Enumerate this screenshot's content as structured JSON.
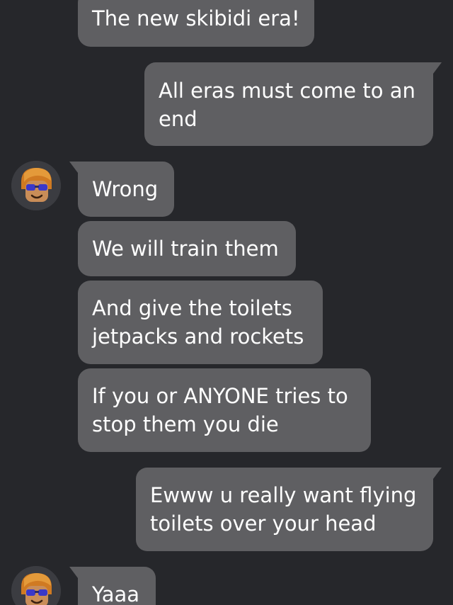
{
  "chat": {
    "messages": [
      {
        "sender": "other",
        "lines": [
          "The new skibidi era!"
        ]
      },
      {
        "sender": "me",
        "lines": [
          "All eras must come to an",
          "end"
        ]
      },
      {
        "sender": "other",
        "lines": [
          "Wrong"
        ]
      },
      {
        "sender": "other",
        "lines": [
          "We will train them"
        ]
      },
      {
        "sender": "other",
        "lines": [
          "And give the toilets",
          "jetpacks and rockets"
        ]
      },
      {
        "sender": "other",
        "lines": [
          "If you or ANYONE tries to",
          "stop them you die"
        ]
      },
      {
        "sender": "me",
        "lines": [
          "Ewww u really want flying",
          "toilets over your head"
        ]
      },
      {
        "sender": "other",
        "lines": [
          "Yaaa"
        ]
      }
    ]
  },
  "colors": {
    "background": "#26272b",
    "bubble": "#5f5f62",
    "text": "#ffffff"
  },
  "icons": {
    "avatar": "user-avatar-icon"
  }
}
